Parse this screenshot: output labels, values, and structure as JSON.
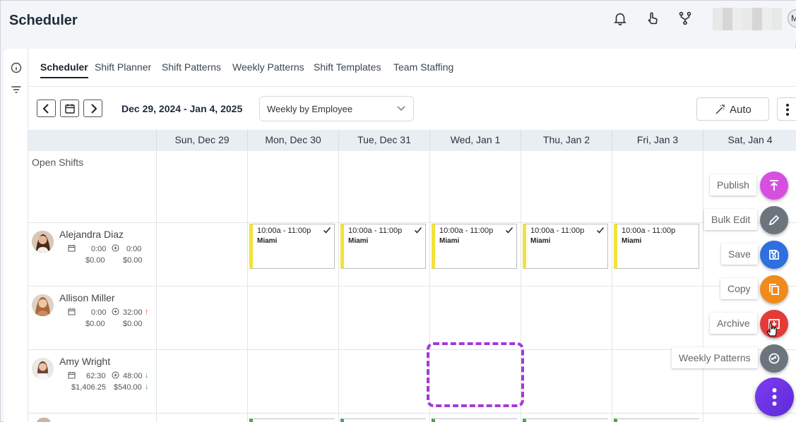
{
  "app": {
    "title": "Scheduler",
    "avatar_initial": "M"
  },
  "tabs": [
    "Scheduler",
    "Shift Planner",
    "Shift Patterns",
    "Weekly Patterns",
    "Shift Templates",
    "Team Staffing"
  ],
  "toolbar": {
    "date_range": "Dec 29, 2024 - Jan 4, 2025",
    "view_select": "Weekly by Employee",
    "auto_label": "Auto"
  },
  "days": [
    "Sun, Dec 29",
    "Mon, Dec 30",
    "Tue, Dec 31",
    "Wed, Jan 1",
    "Thu, Jan 2",
    "Fri, Jan 3",
    "Sat, Jan 4"
  ],
  "open_shifts_label": "Open Shifts",
  "employees": [
    {
      "name": "Alejandra Diaz",
      "hours": "0:00",
      "target": "0:00",
      "cost": "$0.00",
      "target_cost": "$0.00",
      "trend": ""
    },
    {
      "name": "Allison Miller",
      "hours": "0:00",
      "target": "32:00",
      "cost": "$0.00",
      "target_cost": "$0.00",
      "trend": "up"
    },
    {
      "name": "Amy Wright",
      "hours": "62:30",
      "target": "48:00",
      "cost": "$1,406.25",
      "target_cost": "$540.00",
      "trend": "down"
    }
  ],
  "shifts": [
    {
      "time": "10:00a - 11:00p",
      "location": "Miami"
    },
    {
      "time": "10:00a - 11:00p",
      "location": "Miami"
    },
    {
      "time": "10:00a - 11:00p",
      "location": "Miami"
    },
    {
      "time": "10:00a - 11:00p",
      "location": "Miami"
    },
    {
      "time": "10:00a - 11:00p",
      "location": "Miami"
    }
  ],
  "fab_actions": [
    {
      "label": "Publish",
      "color": "#d64fe0",
      "icon": "publish-icon"
    },
    {
      "label": "Bulk Edit",
      "color": "#6c757d",
      "icon": "pencil-icon"
    },
    {
      "label": "Save",
      "color": "#2f6fe0",
      "icon": "save-icon"
    },
    {
      "label": "Copy",
      "color": "#f08a1a",
      "icon": "copy-icon"
    },
    {
      "label": "Archive",
      "color": "#e53a3a",
      "icon": "archive-icon"
    },
    {
      "label": "Weekly Patterns",
      "color": "#6c757d",
      "icon": "recycle-icon"
    }
  ]
}
